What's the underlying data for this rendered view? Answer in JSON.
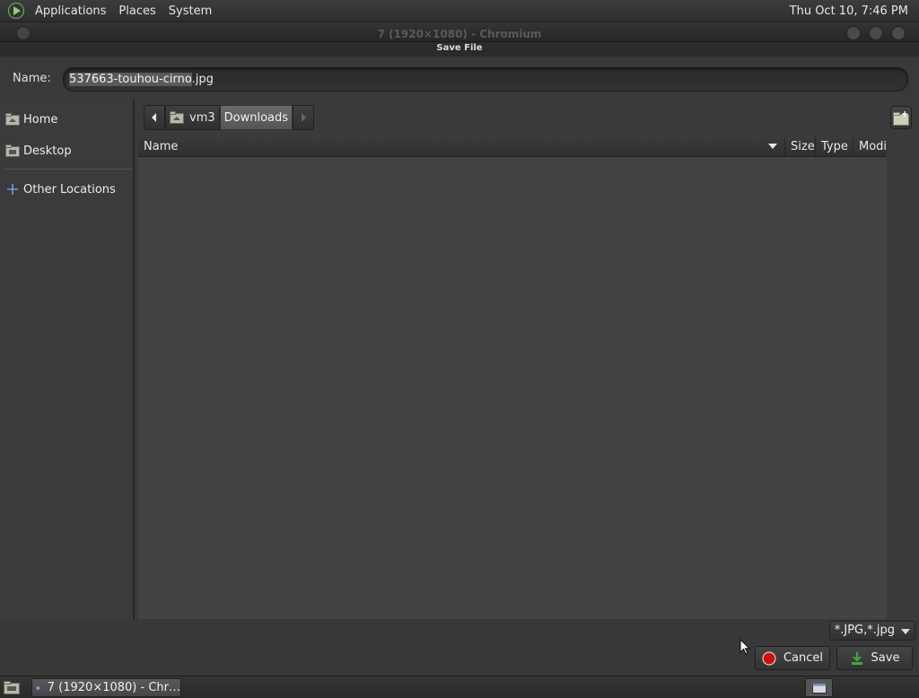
{
  "top_panel": {
    "menus": [
      "Applications",
      "Places",
      "System"
    ],
    "clock": "Thu Oct 10,  7:46 PM"
  },
  "window": {
    "title": "7 (1920×1080) - Chromium"
  },
  "dialog": {
    "title": "Save File",
    "name_label": "Name:",
    "name_value": {
      "selected": "537663-touhou-cirno",
      "rest": ".jpg"
    }
  },
  "sidebar": {
    "items": [
      {
        "label": "Home",
        "icon": "home-folder-icon"
      },
      {
        "label": "Desktop",
        "icon": "desktop-folder-icon"
      },
      {
        "label": "Other Locations",
        "icon": "plus-icon"
      }
    ]
  },
  "pathbar": {
    "segments": [
      "vm3",
      "Downloads"
    ]
  },
  "file_list": {
    "columns": [
      "Name",
      "Size",
      "Type",
      "Modif"
    ],
    "rows": []
  },
  "filter": {
    "value": "*.JPG,*.jpg"
  },
  "buttons": {
    "cancel": "Cancel",
    "save": "Save"
  },
  "taskbar": {
    "task_label": "7 (1920×1080) - Chr…"
  },
  "colors": {
    "background": "#3a3a3a",
    "panel": "#2e2e2e",
    "selection": "#5a5a5a",
    "cancel_icon": "#cc1111",
    "save_icon": "#3fa83f"
  }
}
